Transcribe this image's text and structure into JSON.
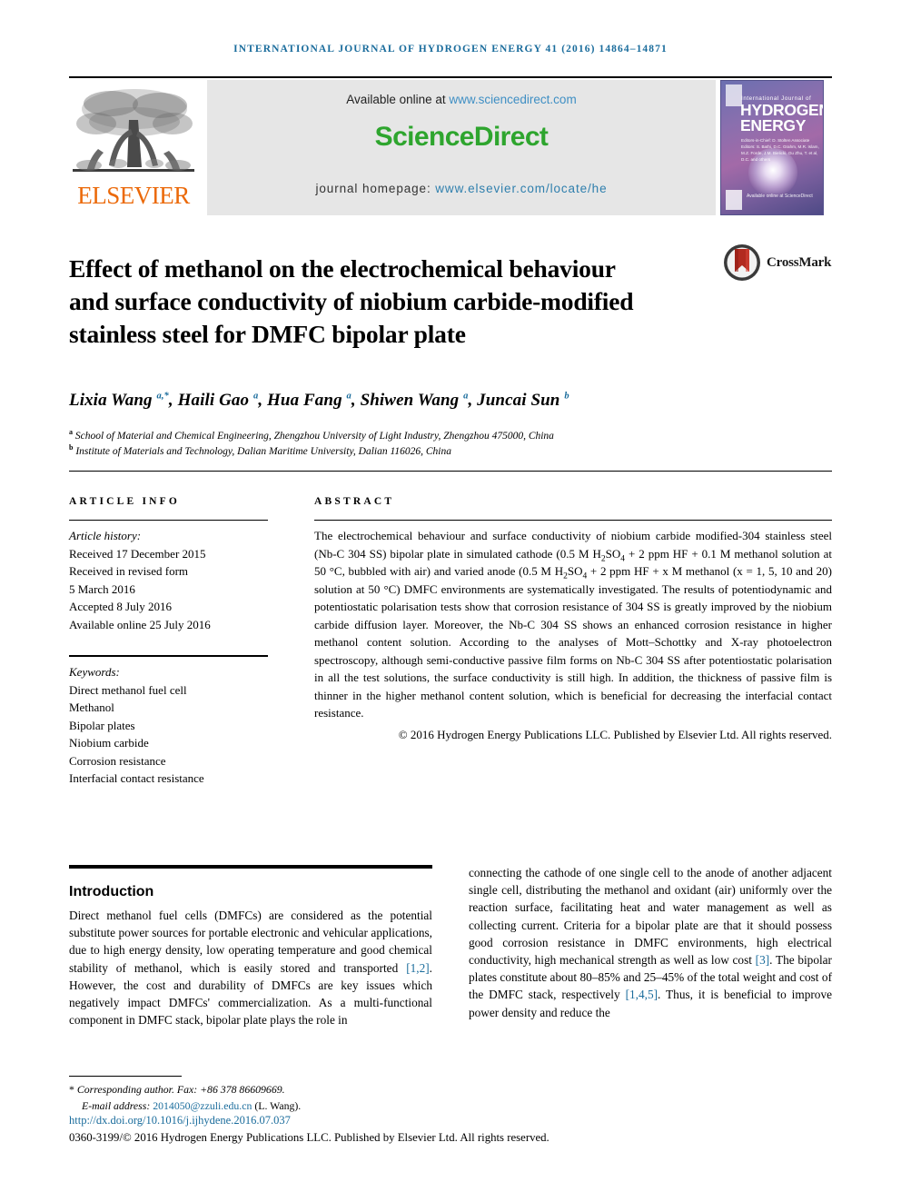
{
  "running_head": "INTERNATIONAL JOURNAL OF HYDROGEN ENERGY 41 (2016) 14864–14871",
  "masthead": {
    "publisher_name": "ELSEVIER",
    "available_prefix": "Available online at ",
    "available_url": "www.sciencedirect.com",
    "wordmark": "ScienceDirect",
    "homepage_prefix": "journal homepage: ",
    "homepage_url": "www.elsevier.com/locate/he",
    "cover": {
      "small_line": "International Journal of",
      "line1": "HYDROGEN",
      "line2": "ENERGY",
      "editors": "Editors-in-Chief: D. Stolten\nAssociate Editors: S. Bathi, D.C. Grahm, M.R. Islam,\nM.Z. Forde, J.M. Bielicki,\nGu Zhu, T. et al, D.C. and others",
      "sciencedirect_label": "Available online at\nScienceDirect"
    }
  },
  "article": {
    "title": "Effect of methanol on the electrochemical behaviour and surface conductivity of niobium carbide-modified stainless steel for DMFC bipolar plate",
    "crossmark_label": "CrossMark",
    "authors": [
      {
        "name": "Lixia Wang",
        "marks": "a,*"
      },
      {
        "name": "Haili Gao",
        "marks": "a"
      },
      {
        "name": "Hua Fang",
        "marks": "a"
      },
      {
        "name": "Shiwen Wang",
        "marks": "a"
      },
      {
        "name": "Juncai Sun",
        "marks": "b"
      }
    ],
    "affiliations": [
      {
        "mark": "a",
        "text": "School of Material and Chemical Engineering, Zhengzhou University of Light Industry, Zhengzhou 475000, China"
      },
      {
        "mark": "b",
        "text": "Institute of Materials and Technology, Dalian Maritime University, Dalian 116026, China"
      }
    ]
  },
  "article_info": {
    "heading": "ARTICLE INFO",
    "history_label": "Article history:",
    "history": [
      "Received 17 December 2015",
      "Received in revised form",
      "5 March 2016",
      "Accepted 8 July 2016",
      "Available online 25 July 2016"
    ],
    "keywords_label": "Keywords:",
    "keywords": [
      "Direct methanol fuel cell",
      "Methanol",
      "Bipolar plates",
      "Niobium carbide",
      "Corrosion resistance",
      "Interfacial contact resistance"
    ]
  },
  "abstract": {
    "heading": "ABSTRACT",
    "copyright": "© 2016 Hydrogen Energy Publications LLC. Published by Elsevier Ltd. All rights reserved."
  },
  "body": {
    "section_title": "Introduction",
    "left_paragraph_plain": "Direct methanol fuel cells (DMFCs) are considered as the potential substitute power sources for portable electronic and vehicular applications, due to high energy density, low operating temperature and good chemical stability of methanol, which is easily stored and transported [1,2]. However, the cost and durability of DMFCs are key issues which negatively impact DMFCs' commercialization. As a multi-functional component in DMFC stack, bipolar plate plays the role in",
    "right_paragraph_plain": "connecting the cathode of one single cell to the anode of another adjacent single cell, distributing the methanol and oxidant (air) uniformly over the reaction surface, facilitating heat and water management as well as collecting current. Criteria for a bipolar plate are that it should possess good corrosion resistance in DMFC environments, high electrical conductivity, high mechanical strength as well as low cost [3]. The bipolar plates constitute about 80–85% and 25–45% of the total weight and cost of the DMFC stack, respectively [1,4,5]. Thus, it is beneficial to improve power density and reduce the",
    "citations": [
      "[1,2]",
      "[3]",
      "[1,4,5]"
    ]
  },
  "footer": {
    "corresponding_note": "Corresponding author. Fax: +86 378 86609669.",
    "email_label": "E-mail address:",
    "email": "2014050@zzuli.edu.cn",
    "email_owner": "(L. Wang).",
    "doi": "http://dx.doi.org/10.1016/j.ijhydene.2016.07.037",
    "issn_line": "0360-3199/© 2016 Hydrogen Energy Publications LLC. Published by Elsevier Ltd. All rights reserved."
  },
  "colors": {
    "link_blue": "#1a6c9c",
    "sciencedirect_green": "#2ea52e",
    "elsevier_orange": "#eb6909",
    "crossmark_red": "#b22a20"
  }
}
